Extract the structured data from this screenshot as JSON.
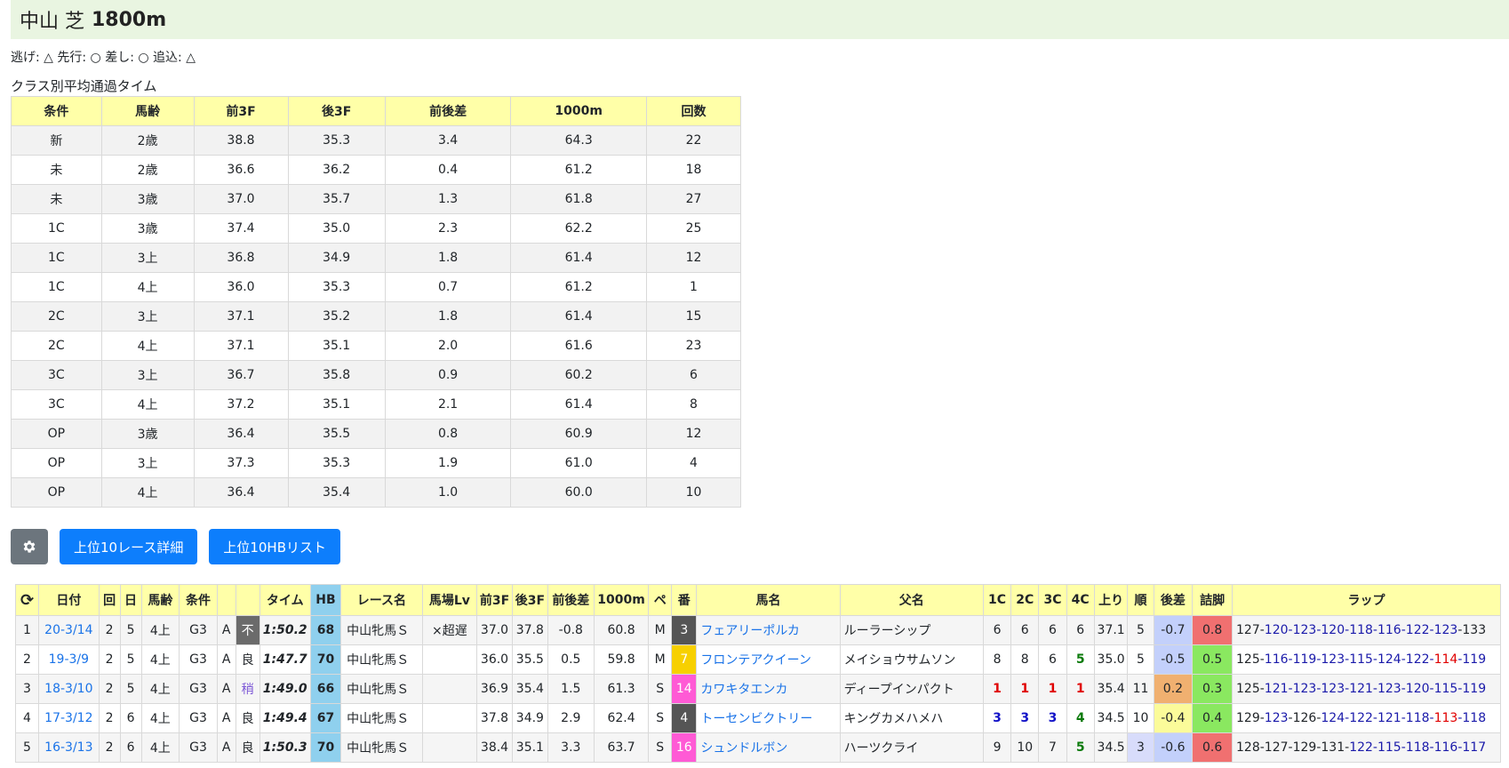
{
  "header": {
    "course": "中山 芝",
    "distance": "1800m"
  },
  "styles_line": "逃げ: △ 先行: ○ 差し: ○ 追込: △",
  "class_table": {
    "title": "クラス別平均通過タイム",
    "headers": [
      "条件",
      "馬齢",
      "前3F",
      "後3F",
      "前後差",
      "1000m",
      "回数"
    ],
    "rows": [
      [
        "新",
        "2歳",
        "38.8",
        "35.3",
        "3.4",
        "64.3",
        "22"
      ],
      [
        "未",
        "2歳",
        "36.6",
        "36.2",
        "0.4",
        "61.2",
        "18"
      ],
      [
        "未",
        "3歳",
        "37.0",
        "35.7",
        "1.3",
        "61.8",
        "27"
      ],
      [
        "1C",
        "3歳",
        "37.4",
        "35.0",
        "2.3",
        "62.2",
        "25"
      ],
      [
        "1C",
        "3上",
        "36.8",
        "34.9",
        "1.8",
        "61.4",
        "12"
      ],
      [
        "1C",
        "4上",
        "36.0",
        "35.3",
        "0.7",
        "61.2",
        "1"
      ],
      [
        "2C",
        "3上",
        "37.1",
        "35.2",
        "1.8",
        "61.4",
        "15"
      ],
      [
        "2C",
        "4上",
        "37.1",
        "35.1",
        "2.0",
        "61.6",
        "23"
      ],
      [
        "3C",
        "3上",
        "36.7",
        "35.8",
        "0.9",
        "60.2",
        "6"
      ],
      [
        "3C",
        "4上",
        "37.2",
        "35.1",
        "2.1",
        "61.4",
        "8"
      ],
      [
        "OP",
        "3歳",
        "36.4",
        "35.5",
        "0.8",
        "60.9",
        "12"
      ],
      [
        "OP",
        "3上",
        "37.3",
        "35.3",
        "1.9",
        "61.0",
        "4"
      ],
      [
        "OP",
        "4上",
        "36.4",
        "35.4",
        "1.0",
        "60.0",
        "10"
      ]
    ]
  },
  "buttons": {
    "settings_icon": "gear-icon",
    "top10_detail": "上位10レース詳細",
    "top10_hb": "上位10HBリスト"
  },
  "race_table": {
    "refresh_icon": "refresh-icon",
    "headers": [
      "日付",
      "回",
      "日",
      "馬齢",
      "条件",
      "",
      "",
      "タイム",
      "HB",
      "レース名",
      "馬場Lv",
      "前3F",
      "後3F",
      "前後差",
      "1000m",
      "ペ",
      "番",
      "馬名",
      "父名",
      "1C",
      "2C",
      "3C",
      "4C",
      "上り",
      "順",
      "後差",
      "詰脚",
      "ラップ"
    ],
    "rows": [
      {
        "idx": "1",
        "date": "20-3/14",
        "kai": "2",
        "day": "5",
        "age": "4上",
        "cond": "G3",
        "grade": "A",
        "baba": "不",
        "baba_style": "bad",
        "time": "1:50.2",
        "hb": "68",
        "race": "中山牝馬Ｓ",
        "babalv": "×超遅",
        "f3": "37.0",
        "l3": "37.8",
        "diff": "-0.8",
        "m1000": "60.8",
        "pace": "M",
        "num": "3",
        "num_style": "dark",
        "horse": "フェアリーポルカ",
        "sire": "ルーラーシップ",
        "c1": "6",
        "c2": "6",
        "c3": "6",
        "c4": "6",
        "c1s": "",
        "c2s": "",
        "c3s": "",
        "c4s": "",
        "agari": "37.1",
        "rank": "5",
        "rank_bg": "",
        "godiff": "-0.7",
        "godiff_bg": "#c3d0fb",
        "tsume": "0.8",
        "tsume_bg": "#f07070",
        "lap": [
          {
            "t": "127",
            "c": ""
          },
          {
            "t": "-",
            "c": ""
          },
          {
            "t": "120",
            "c": "blue"
          },
          {
            "t": "-",
            "c": "blue"
          },
          {
            "t": "123",
            "c": "blue"
          },
          {
            "t": "-",
            "c": "blue"
          },
          {
            "t": "120",
            "c": "blue"
          },
          {
            "t": "-",
            "c": "blue"
          },
          {
            "t": "118",
            "c": "blue"
          },
          {
            "t": "-",
            "c": "blue"
          },
          {
            "t": "116",
            "c": "blue"
          },
          {
            "t": "-",
            "c": "blue"
          },
          {
            "t": "122",
            "c": "blue"
          },
          {
            "t": "-",
            "c": "blue"
          },
          {
            "t": "123",
            "c": "blue"
          },
          {
            "t": "-",
            "c": ""
          },
          {
            "t": "133",
            "c": ""
          }
        ]
      },
      {
        "idx": "2",
        "date": "19-3/9",
        "kai": "2",
        "day": "5",
        "age": "4上",
        "cond": "G3",
        "grade": "A",
        "baba": "良",
        "baba_style": "good",
        "time": "1:47.7",
        "hb": "70",
        "race": "中山牝馬Ｓ",
        "babalv": "",
        "f3": "36.0",
        "l3": "35.5",
        "diff": "0.5",
        "m1000": "59.8",
        "pace": "M",
        "num": "7",
        "num_style": "yellow",
        "horse": "フロンテアクイーン",
        "sire": "メイショウサムソン",
        "c1": "8",
        "c2": "8",
        "c3": "6",
        "c4": "5",
        "c1s": "",
        "c2s": "",
        "c3s": "",
        "c4s": "green",
        "agari": "35.0",
        "rank": "5",
        "rank_bg": "",
        "godiff": "-0.5",
        "godiff_bg": "#c3d0fb",
        "tsume": "0.5",
        "tsume_bg": "#8ae860",
        "lap": [
          {
            "t": "125",
            "c": ""
          },
          {
            "t": "-",
            "c": ""
          },
          {
            "t": "116",
            "c": "blue"
          },
          {
            "t": "-",
            "c": "blue"
          },
          {
            "t": "119",
            "c": "blue"
          },
          {
            "t": "-",
            "c": "blue"
          },
          {
            "t": "123",
            "c": "blue"
          },
          {
            "t": "-",
            "c": "blue"
          },
          {
            "t": "115",
            "c": "blue"
          },
          {
            "t": "-",
            "c": "blue"
          },
          {
            "t": "124",
            "c": "blue"
          },
          {
            "t": "-",
            "c": "blue"
          },
          {
            "t": "122",
            "c": "blue"
          },
          {
            "t": "-",
            "c": "blue"
          },
          {
            "t": "114",
            "c": "red"
          },
          {
            "t": "-",
            "c": "blue"
          },
          {
            "t": "119",
            "c": "blue"
          }
        ]
      },
      {
        "idx": "3",
        "date": "18-3/10",
        "kai": "2",
        "day": "5",
        "age": "4上",
        "cond": "G3",
        "grade": "A",
        "baba": "稍",
        "baba_style": "slight",
        "time": "1:49.0",
        "hb": "66",
        "race": "中山牝馬Ｓ",
        "babalv": "",
        "f3": "36.9",
        "l3": "35.4",
        "diff": "1.5",
        "m1000": "61.3",
        "pace": "S",
        "num": "14",
        "num_style": "pink",
        "horse": "カワキタエンカ",
        "sire": "ディープインパクト",
        "c1": "1",
        "c2": "1",
        "c3": "1",
        "c4": "1",
        "c1s": "red",
        "c2s": "red",
        "c3s": "red",
        "c4s": "red",
        "agari": "35.4",
        "rank": "11",
        "rank_bg": "",
        "godiff": "0.2",
        "godiff_bg": "#f0b070",
        "tsume": "0.3",
        "tsume_bg": "#8ae860",
        "lap": [
          {
            "t": "125",
            "c": ""
          },
          {
            "t": "-",
            "c": ""
          },
          {
            "t": "121",
            "c": "blue"
          },
          {
            "t": "-",
            "c": "blue"
          },
          {
            "t": "123",
            "c": "blue"
          },
          {
            "t": "-",
            "c": "blue"
          },
          {
            "t": "123",
            "c": "blue"
          },
          {
            "t": "-",
            "c": "blue"
          },
          {
            "t": "121",
            "c": "blue"
          },
          {
            "t": "-",
            "c": "blue"
          },
          {
            "t": "123",
            "c": "blue"
          },
          {
            "t": "-",
            "c": "blue"
          },
          {
            "t": "120",
            "c": "blue"
          },
          {
            "t": "-",
            "c": "blue"
          },
          {
            "t": "115",
            "c": "blue"
          },
          {
            "t": "-",
            "c": "blue"
          },
          {
            "t": "119",
            "c": "blue"
          }
        ]
      },
      {
        "idx": "4",
        "date": "17-3/12",
        "kai": "2",
        "day": "6",
        "age": "4上",
        "cond": "G3",
        "grade": "A",
        "baba": "良",
        "baba_style": "good",
        "time": "1:49.4",
        "hb": "67",
        "race": "中山牝馬Ｓ",
        "babalv": "",
        "f3": "37.8",
        "l3": "34.9",
        "diff": "2.9",
        "m1000": "62.4",
        "pace": "S",
        "num": "4",
        "num_style": "dark",
        "horse": "トーセンビクトリー",
        "sire": "キングカメハメハ",
        "c1": "3",
        "c2": "3",
        "c3": "3",
        "c4": "4",
        "c1s": "blue",
        "c2s": "blue",
        "c3s": "blue",
        "c4s": "green",
        "agari": "34.5",
        "rank": "10",
        "rank_bg": "",
        "godiff": "-0.4",
        "godiff_bg": "#fbfb9a",
        "tsume": "0.4",
        "tsume_bg": "#8ae860",
        "lap": [
          {
            "t": "129",
            "c": ""
          },
          {
            "t": "-",
            "c": ""
          },
          {
            "t": "123",
            "c": "blue"
          },
          {
            "t": "-",
            "c": ""
          },
          {
            "t": "126",
            "c": ""
          },
          {
            "t": "-",
            "c": ""
          },
          {
            "t": "124",
            "c": "blue"
          },
          {
            "t": "-",
            "c": "blue"
          },
          {
            "t": "122",
            "c": "blue"
          },
          {
            "t": "-",
            "c": "blue"
          },
          {
            "t": "121",
            "c": "blue"
          },
          {
            "t": "-",
            "c": "blue"
          },
          {
            "t": "118",
            "c": "blue"
          },
          {
            "t": "-",
            "c": "blue"
          },
          {
            "t": "113",
            "c": "red"
          },
          {
            "t": "-",
            "c": "blue"
          },
          {
            "t": "118",
            "c": "blue"
          }
        ]
      },
      {
        "idx": "5",
        "date": "16-3/13",
        "kai": "2",
        "day": "6",
        "age": "4上",
        "cond": "G3",
        "grade": "A",
        "baba": "良",
        "baba_style": "good",
        "time": "1:50.3",
        "hb": "70",
        "race": "中山牝馬Ｓ",
        "babalv": "",
        "f3": "38.4",
        "l3": "35.1",
        "diff": "3.3",
        "m1000": "63.7",
        "pace": "S",
        "num": "16",
        "num_style": "pink",
        "horse": "シュンドルボン",
        "sire": "ハーツクライ",
        "c1": "9",
        "c2": "10",
        "c3": "7",
        "c4": "5",
        "c1s": "",
        "c2s": "",
        "c3s": "",
        "c4s": "green",
        "agari": "34.5",
        "rank": "3",
        "rank_bg": "#d8dcfb",
        "godiff": "-0.6",
        "godiff_bg": "#c3d0fb",
        "tsume": "0.6",
        "tsume_bg": "#f07070",
        "lap": [
          {
            "t": "128",
            "c": ""
          },
          {
            "t": "-",
            "c": ""
          },
          {
            "t": "127",
            "c": ""
          },
          {
            "t": "-",
            "c": ""
          },
          {
            "t": "129",
            "c": ""
          },
          {
            "t": "-",
            "c": ""
          },
          {
            "t": "131",
            "c": ""
          },
          {
            "t": "-",
            "c": ""
          },
          {
            "t": "122",
            "c": "blue"
          },
          {
            "t": "-",
            "c": "blue"
          },
          {
            "t": "115",
            "c": "blue"
          },
          {
            "t": "-",
            "c": "blue"
          },
          {
            "t": "118",
            "c": "blue"
          },
          {
            "t": "-",
            "c": "blue"
          },
          {
            "t": "116",
            "c": "blue"
          },
          {
            "t": "-",
            "c": "blue"
          },
          {
            "t": "117",
            "c": "blue"
          }
        ]
      }
    ]
  }
}
